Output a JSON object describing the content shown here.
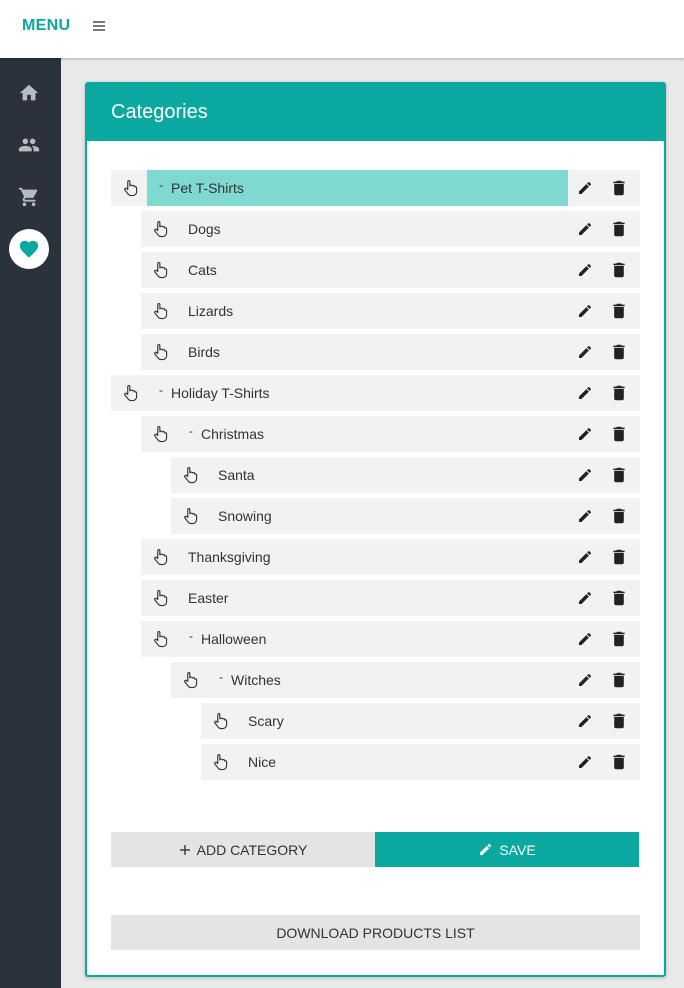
{
  "header": {
    "brand": "MENU",
    "menu_icon": "hamburger-icon"
  },
  "colors": {
    "accent": "#0aa89e",
    "highlight": "#7fd9d1",
    "sidebar_bg": "#2b323b",
    "row_bg": "#f1f2f2"
  },
  "sidebar": {
    "items": [
      {
        "icon": "home-icon",
        "active": false
      },
      {
        "icon": "users-icon",
        "active": false
      },
      {
        "icon": "cart-icon",
        "active": false
      },
      {
        "icon": "heart-icon",
        "active": true
      }
    ]
  },
  "card": {
    "title": "Categories"
  },
  "tree": [
    {
      "label": "Pet T-Shirts",
      "depth": 0,
      "toggle": "-",
      "selected": true
    },
    {
      "label": "Dogs",
      "depth": 1,
      "toggle": ""
    },
    {
      "label": "Cats",
      "depth": 1,
      "toggle": ""
    },
    {
      "label": "Lizards",
      "depth": 1,
      "toggle": ""
    },
    {
      "label": "Birds",
      "depth": 1,
      "toggle": ""
    },
    {
      "label": "Holiday T-Shirts",
      "depth": 0,
      "toggle": "-"
    },
    {
      "label": "Christmas",
      "depth": 1,
      "toggle": "-"
    },
    {
      "label": "Santa",
      "depth": 2,
      "toggle": ""
    },
    {
      "label": "Snowing",
      "depth": 2,
      "toggle": ""
    },
    {
      "label": "Thanksgiving",
      "depth": 1,
      "toggle": ""
    },
    {
      "label": "Easter",
      "depth": 1,
      "toggle": ""
    },
    {
      "label": "Halloween",
      "depth": 1,
      "toggle": "-"
    },
    {
      "label": "Witches",
      "depth": 2,
      "toggle": "-"
    },
    {
      "label": "Scary",
      "depth": 3,
      "toggle": ""
    },
    {
      "label": "Nice",
      "depth": 3,
      "toggle": ""
    }
  ],
  "buttons": {
    "add_label": "ADD CATEGORY",
    "save_label": "SAVE",
    "download_label": "DOWNLOAD PRODUCTS LIST"
  }
}
